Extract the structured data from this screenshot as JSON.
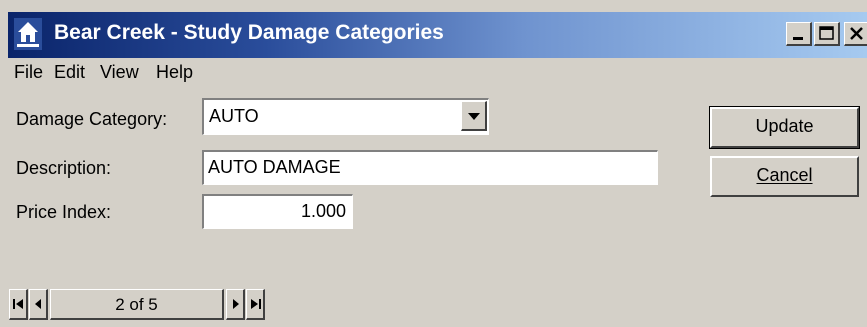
{
  "window": {
    "title": "Bear Creek - Study Damage Categories",
    "icon": "house-app-icon"
  },
  "menu": {
    "file_label": "File",
    "edit_label": "Edit",
    "view_label": "View",
    "help_label": "Help"
  },
  "form": {
    "damage_category_label": "Damage Category:",
    "damage_category_value": "AUTO",
    "description_label": "Description:",
    "description_value": "AUTO DAMAGE",
    "price_index_label": "Price Index:",
    "price_index_value": "1.000"
  },
  "buttons": {
    "update_label": "Update",
    "cancel_label": "Cancel"
  },
  "navigator": {
    "record_text": "2 of 5"
  },
  "colors": {
    "face": "#d4d0c8",
    "title_start": "#0a246a",
    "title_end": "#a6caf0"
  }
}
